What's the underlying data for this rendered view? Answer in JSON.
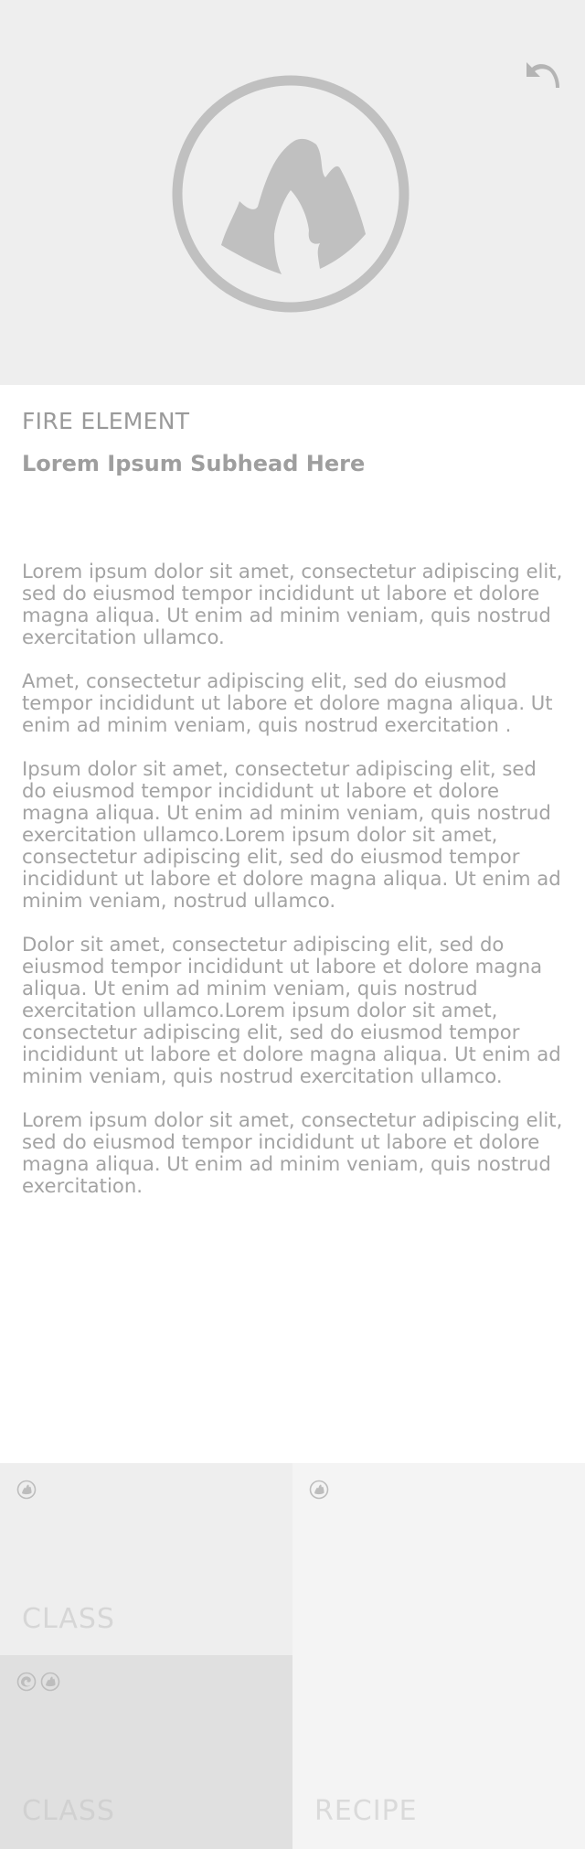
{
  "hero": {
    "emblem_icon": "fire-element-icon",
    "back_icon": "undo-arrow-icon",
    "background_color": "#eeeeee",
    "icon_color": "#c0c0c0"
  },
  "article": {
    "title": "FIRE ELEMENT",
    "subhead": "Lorem Ipsum Subhead Here",
    "paragraphs": [
      "Lorem ipsum dolor sit amet, consectetur adipiscing elit, sed do eiusmod tempor incididunt ut labore et dolore magna aliqua. Ut enim ad minim veniam, quis nostrud exercitation ullamco.",
      "Amet, consectetur adipiscing elit, sed do eiusmod tempor incididunt ut labore et dolore magna aliqua. Ut enim ad minim veniam, quis nostrud exercitation .",
      "Ipsum dolor sit amet, consectetur adipiscing elit, sed do eiusmod tempor incididunt ut labore et dolore magna aliqua. Ut enim ad minim veniam, quis nostrud exercitation ullamco.Lorem ipsum dolor sit amet, consectetur adipiscing elit, sed do eiusmod tempor incididunt ut labore et dolore magna aliqua. Ut enim ad minim veniam, nostrud ullamco.",
      "Dolor sit amet, consectetur adipiscing elit, sed do eiusmod tempor incididunt ut labore et dolore magna aliqua. Ut enim ad minim veniam, quis nostrud exercitation ullamco.Lorem ipsum dolor sit amet, consectetur adipiscing elit, sed do eiusmod tempor incididunt ut labore et dolore magna aliqua. Ut enim ad minim veniam, quis nostrud exercitation ullamco.",
      "Lorem ipsum dolor sit amet, consectetur adipiscing elit, sed do eiusmod tempor incididunt ut labore et dolore magna aliqua. Ut enim ad minim veniam, quis nostrud exercitation."
    ]
  },
  "tiles": [
    {
      "label": "CLASS",
      "icons": [
        "fire-element-icon"
      ]
    },
    {
      "label": "CLASS",
      "icons": [
        "water-element-icon",
        "fire-element-icon"
      ]
    },
    {
      "label": "RECIPE",
      "icons": [
        "fire-element-icon"
      ]
    }
  ]
}
